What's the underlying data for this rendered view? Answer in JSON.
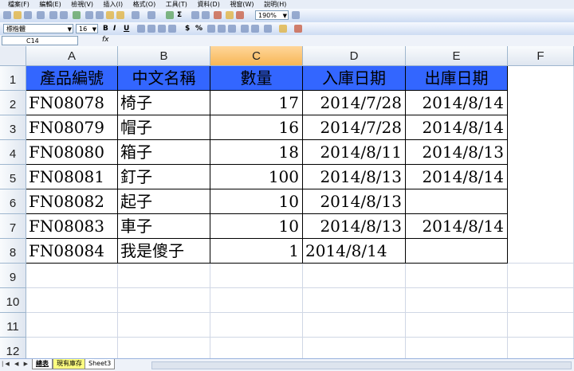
{
  "menu": [
    "檔案(F)",
    "編輯(E)",
    "檢視(V)",
    "插入(I)",
    "格式(O)",
    "工具(T)",
    "資料(D)",
    "視窗(W)",
    "說明(H)"
  ],
  "toolbar": {
    "zoom": "190%",
    "font_name": "標楷體",
    "font_size": "16",
    "bold": "B",
    "italic": "I",
    "underline": "U",
    "currency": "$",
    "percent": "%",
    "sigma": "Σ"
  },
  "formula_bar": {
    "name_box": "C14",
    "fx": "fx"
  },
  "columns": [
    "A",
    "B",
    "C",
    "D",
    "E",
    "F"
  ],
  "selected_column": "C",
  "rows": [
    "1",
    "2",
    "3",
    "4",
    "5",
    "6",
    "7",
    "8",
    "9",
    "10",
    "11",
    "12"
  ],
  "header_row": [
    "產品編號",
    "中文名稱",
    "數量",
    "入庫日期",
    "出庫日期"
  ],
  "data_rows": [
    [
      "FN08078",
      "椅子",
      "17",
      "2014/7/28",
      "2014/8/14"
    ],
    [
      "FN08079",
      "帽子",
      "16",
      "2014/7/28",
      "2014/8/14"
    ],
    [
      "FN08080",
      "箱子",
      "18",
      "2014/8/11",
      "2014/8/13"
    ],
    [
      "FN08081",
      "釘子",
      "100",
      "2014/8/13",
      "2014/8/14"
    ],
    [
      "FN08082",
      "起子",
      "10",
      "2014/8/13",
      ""
    ],
    [
      "FN08083",
      "車子",
      "10",
      "2014/8/13",
      "2014/8/14"
    ],
    [
      "FN08084",
      "我是傻子",
      "1",
      "2014/8/14",
      ""
    ]
  ],
  "sheet_tabs": [
    "總表",
    "現有庫存",
    "Sheet3"
  ],
  "colors": {
    "header_fill": "#3366ff",
    "selected_header": "#f7b756",
    "tab_highlight": "#ffff80"
  }
}
